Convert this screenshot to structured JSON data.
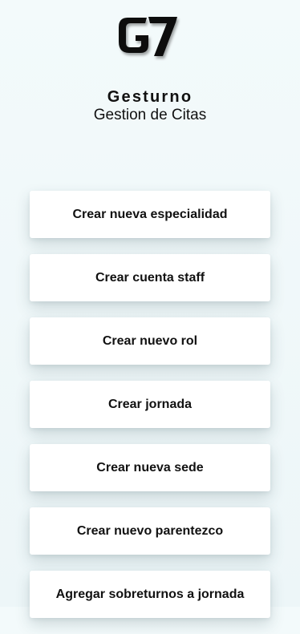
{
  "brand": {
    "title": "Gesturno",
    "subtitle": "Gestion de Citas",
    "logo_text": "G7"
  },
  "menu": {
    "items": [
      {
        "label": "Crear nueva especialidad"
      },
      {
        "label": "Crear cuenta staff"
      },
      {
        "label": "Crear nuevo rol"
      },
      {
        "label": "Crear jornada"
      },
      {
        "label": "Crear nueva sede"
      },
      {
        "label": "Crear nuevo parentezco"
      },
      {
        "label": "Agregar sobreturnos a jornada"
      }
    ]
  },
  "colors": {
    "background": "#f1f8fa",
    "button_bg": "#ffffff",
    "text": "#111111"
  }
}
